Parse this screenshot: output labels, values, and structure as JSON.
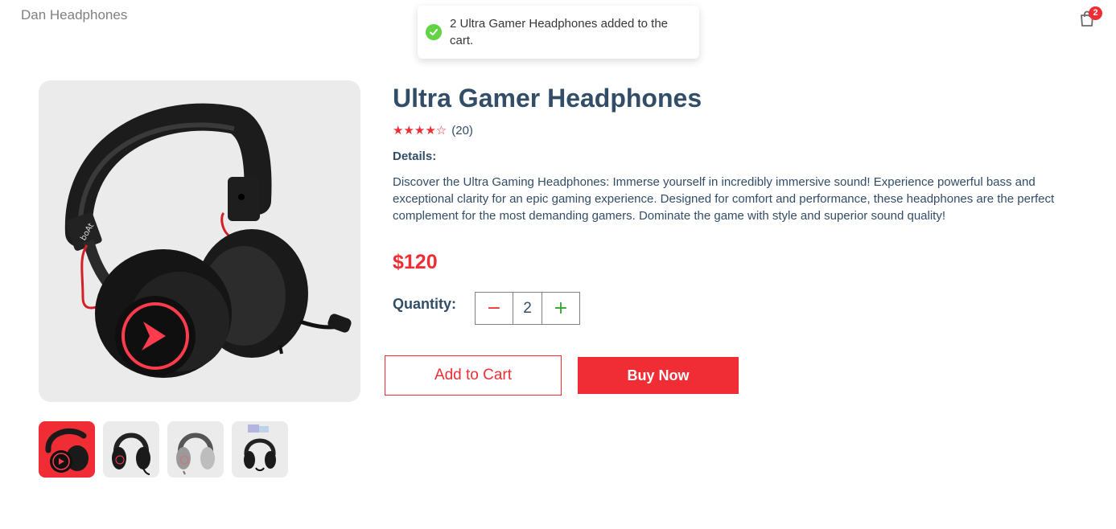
{
  "header": {
    "brand": "Dan Headphones",
    "cart_count": "2",
    "cart_icon": "shopping-bag-icon"
  },
  "toast": {
    "icon": "check-circle-icon",
    "message": "2 Ultra Gamer Headphones added to the cart."
  },
  "product": {
    "title": "Ultra Gamer Headphones",
    "rating": 4,
    "rating_max": 5,
    "stars_display": "★★★★☆",
    "reviews": "(20)",
    "details_heading": "Details:",
    "description": "Discover the Ultra Gaming Headphones: Immerse yourself in incredibly immersive sound! Experience powerful bass and exceptional clarity for an epic gaming experience. Designed for comfort and performance, these headphones are the perfect complement for the most demanding gamers. Dominate the game with style and superior sound quality!",
    "price": "$120",
    "image_logo_text": "boAt"
  },
  "thumbnails": {
    "selected_index": 0,
    "count": 4
  },
  "quantity": {
    "label": "Quantity:",
    "minus": "−",
    "value": "2",
    "plus": "+"
  },
  "actions": {
    "add_to_cart": "Add to Cart",
    "buy_now": "Buy Now"
  },
  "colors": {
    "accent": "#f02d34",
    "text": "#324d67",
    "success": "#61d345",
    "plus": "#31a831",
    "image_bg": "#ebebeb"
  }
}
